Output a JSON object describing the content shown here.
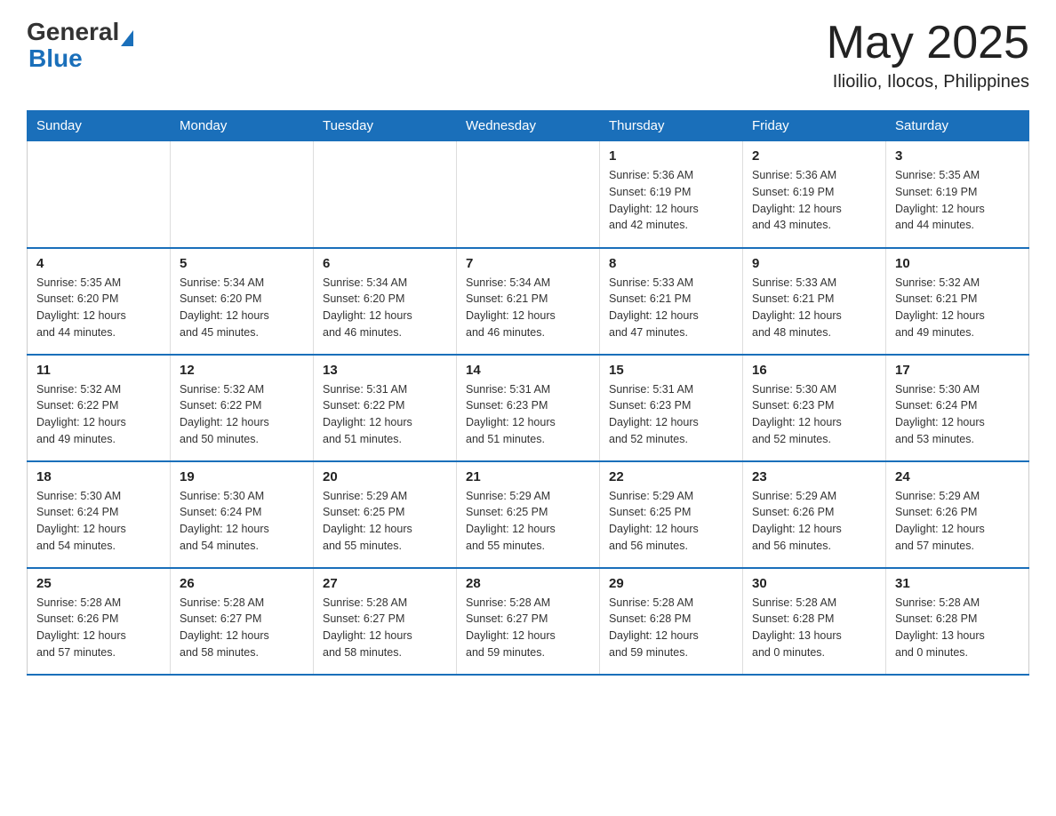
{
  "header": {
    "logo_general": "General",
    "logo_blue": "Blue",
    "month_year": "May 2025",
    "location": "Ilioilio, Ilocos, Philippines"
  },
  "days_of_week": [
    "Sunday",
    "Monday",
    "Tuesday",
    "Wednesday",
    "Thursday",
    "Friday",
    "Saturday"
  ],
  "weeks": [
    [
      {
        "day": "",
        "info": ""
      },
      {
        "day": "",
        "info": ""
      },
      {
        "day": "",
        "info": ""
      },
      {
        "day": "",
        "info": ""
      },
      {
        "day": "1",
        "info": "Sunrise: 5:36 AM\nSunset: 6:19 PM\nDaylight: 12 hours\nand 42 minutes."
      },
      {
        "day": "2",
        "info": "Sunrise: 5:36 AM\nSunset: 6:19 PM\nDaylight: 12 hours\nand 43 minutes."
      },
      {
        "day": "3",
        "info": "Sunrise: 5:35 AM\nSunset: 6:19 PM\nDaylight: 12 hours\nand 44 minutes."
      }
    ],
    [
      {
        "day": "4",
        "info": "Sunrise: 5:35 AM\nSunset: 6:20 PM\nDaylight: 12 hours\nand 44 minutes."
      },
      {
        "day": "5",
        "info": "Sunrise: 5:34 AM\nSunset: 6:20 PM\nDaylight: 12 hours\nand 45 minutes."
      },
      {
        "day": "6",
        "info": "Sunrise: 5:34 AM\nSunset: 6:20 PM\nDaylight: 12 hours\nand 46 minutes."
      },
      {
        "day": "7",
        "info": "Sunrise: 5:34 AM\nSunset: 6:21 PM\nDaylight: 12 hours\nand 46 minutes."
      },
      {
        "day": "8",
        "info": "Sunrise: 5:33 AM\nSunset: 6:21 PM\nDaylight: 12 hours\nand 47 minutes."
      },
      {
        "day": "9",
        "info": "Sunrise: 5:33 AM\nSunset: 6:21 PM\nDaylight: 12 hours\nand 48 minutes."
      },
      {
        "day": "10",
        "info": "Sunrise: 5:32 AM\nSunset: 6:21 PM\nDaylight: 12 hours\nand 49 minutes."
      }
    ],
    [
      {
        "day": "11",
        "info": "Sunrise: 5:32 AM\nSunset: 6:22 PM\nDaylight: 12 hours\nand 49 minutes."
      },
      {
        "day": "12",
        "info": "Sunrise: 5:32 AM\nSunset: 6:22 PM\nDaylight: 12 hours\nand 50 minutes."
      },
      {
        "day": "13",
        "info": "Sunrise: 5:31 AM\nSunset: 6:22 PM\nDaylight: 12 hours\nand 51 minutes."
      },
      {
        "day": "14",
        "info": "Sunrise: 5:31 AM\nSunset: 6:23 PM\nDaylight: 12 hours\nand 51 minutes."
      },
      {
        "day": "15",
        "info": "Sunrise: 5:31 AM\nSunset: 6:23 PM\nDaylight: 12 hours\nand 52 minutes."
      },
      {
        "day": "16",
        "info": "Sunrise: 5:30 AM\nSunset: 6:23 PM\nDaylight: 12 hours\nand 52 minutes."
      },
      {
        "day": "17",
        "info": "Sunrise: 5:30 AM\nSunset: 6:24 PM\nDaylight: 12 hours\nand 53 minutes."
      }
    ],
    [
      {
        "day": "18",
        "info": "Sunrise: 5:30 AM\nSunset: 6:24 PM\nDaylight: 12 hours\nand 54 minutes."
      },
      {
        "day": "19",
        "info": "Sunrise: 5:30 AM\nSunset: 6:24 PM\nDaylight: 12 hours\nand 54 minutes."
      },
      {
        "day": "20",
        "info": "Sunrise: 5:29 AM\nSunset: 6:25 PM\nDaylight: 12 hours\nand 55 minutes."
      },
      {
        "day": "21",
        "info": "Sunrise: 5:29 AM\nSunset: 6:25 PM\nDaylight: 12 hours\nand 55 minutes."
      },
      {
        "day": "22",
        "info": "Sunrise: 5:29 AM\nSunset: 6:25 PM\nDaylight: 12 hours\nand 56 minutes."
      },
      {
        "day": "23",
        "info": "Sunrise: 5:29 AM\nSunset: 6:26 PM\nDaylight: 12 hours\nand 56 minutes."
      },
      {
        "day": "24",
        "info": "Sunrise: 5:29 AM\nSunset: 6:26 PM\nDaylight: 12 hours\nand 57 minutes."
      }
    ],
    [
      {
        "day": "25",
        "info": "Sunrise: 5:28 AM\nSunset: 6:26 PM\nDaylight: 12 hours\nand 57 minutes."
      },
      {
        "day": "26",
        "info": "Sunrise: 5:28 AM\nSunset: 6:27 PM\nDaylight: 12 hours\nand 58 minutes."
      },
      {
        "day": "27",
        "info": "Sunrise: 5:28 AM\nSunset: 6:27 PM\nDaylight: 12 hours\nand 58 minutes."
      },
      {
        "day": "28",
        "info": "Sunrise: 5:28 AM\nSunset: 6:27 PM\nDaylight: 12 hours\nand 59 minutes."
      },
      {
        "day": "29",
        "info": "Sunrise: 5:28 AM\nSunset: 6:28 PM\nDaylight: 12 hours\nand 59 minutes."
      },
      {
        "day": "30",
        "info": "Sunrise: 5:28 AM\nSunset: 6:28 PM\nDaylight: 13 hours\nand 0 minutes."
      },
      {
        "day": "31",
        "info": "Sunrise: 5:28 AM\nSunset: 6:28 PM\nDaylight: 13 hours\nand 0 minutes."
      }
    ]
  ]
}
